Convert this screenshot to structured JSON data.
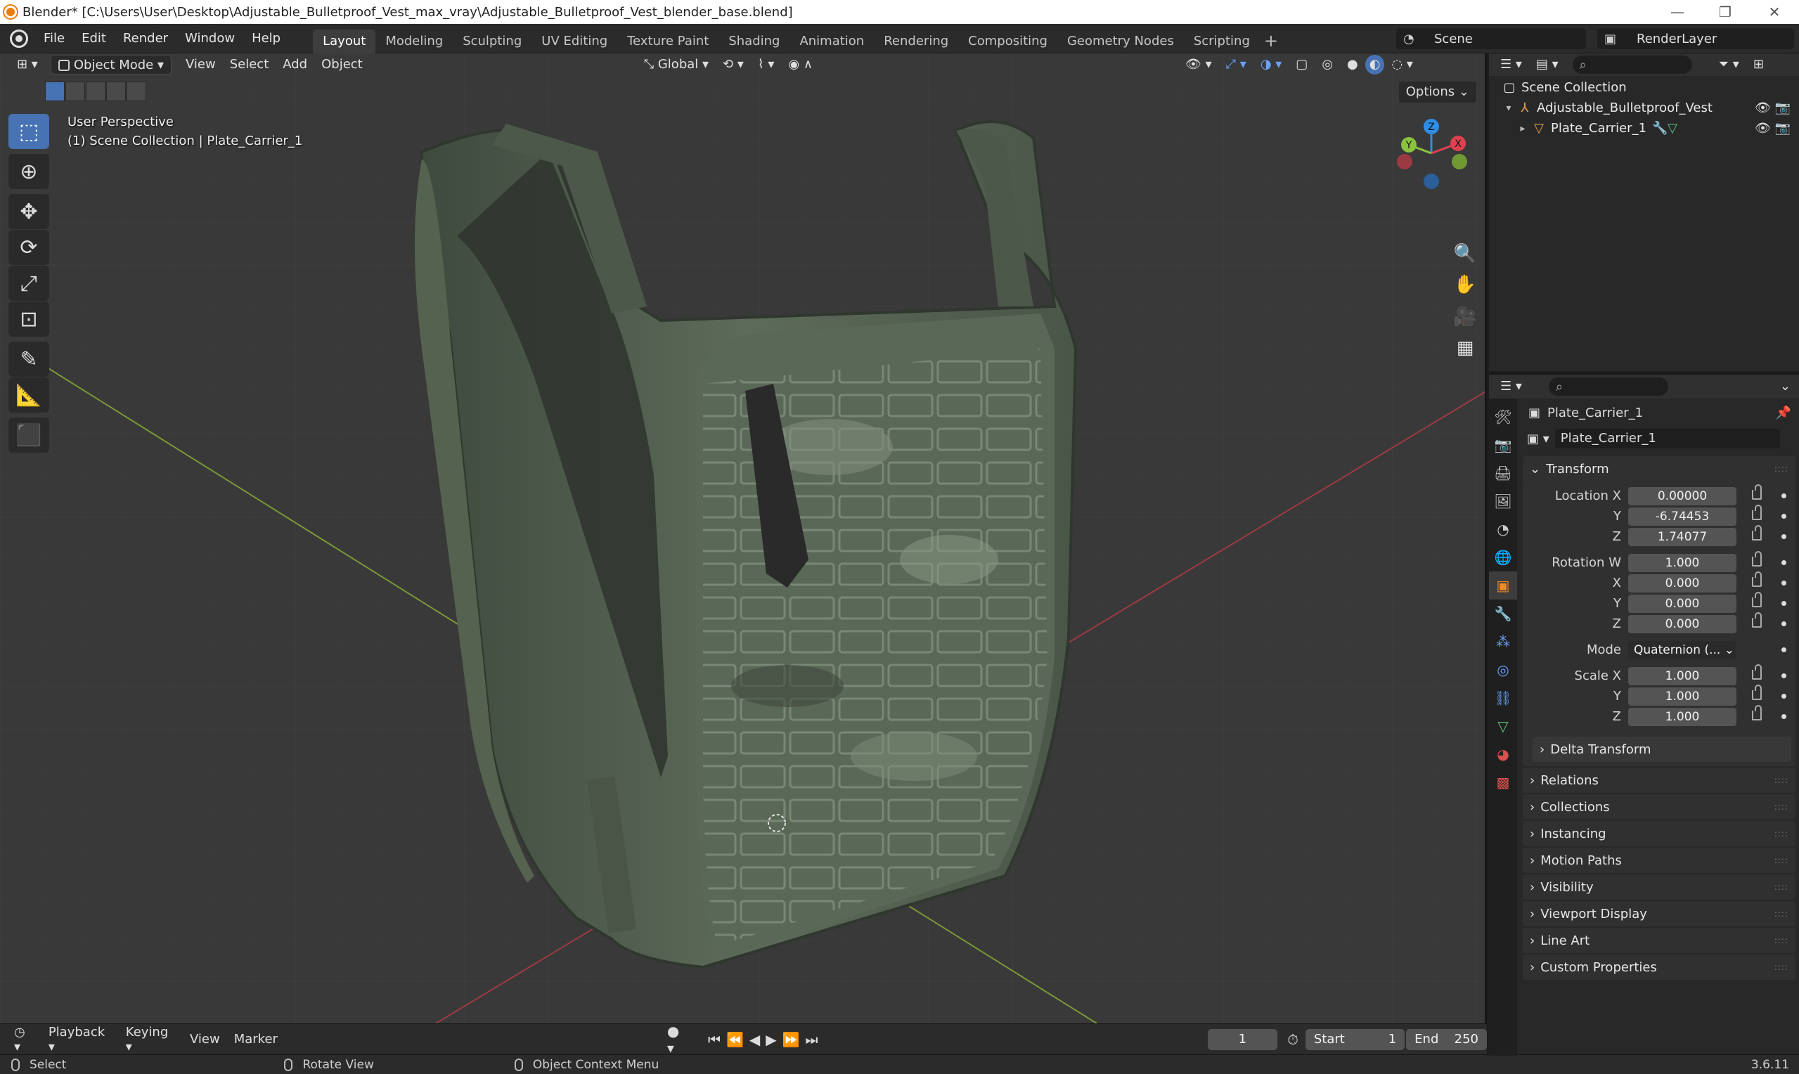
{
  "window": {
    "title": "Blender* [C:\\Users\\User\\Desktop\\Adjustable_Bulletproof_Vest_max_vray\\Adjustable_Bulletproof_Vest_blender_base.blend]"
  },
  "menu": [
    "File",
    "Edit",
    "Render",
    "Window",
    "Help"
  ],
  "workspaces": [
    "Layout",
    "Modeling",
    "Sculpting",
    "UV Editing",
    "Texture Paint",
    "Shading",
    "Animation",
    "Rendering",
    "Compositing",
    "Geometry Nodes",
    "Scripting"
  ],
  "active_workspace": "Layout",
  "scene": "Scene",
  "render_layer": "RenderLayer",
  "viewport": {
    "mode": "Object Mode",
    "menus": [
      "View",
      "Select",
      "Add",
      "Object"
    ],
    "orientation": "Global",
    "options_label": "Options",
    "perspective": "User Perspective",
    "collection_info": "(1) Scene Collection | Plate_Carrier_1",
    "gizmo_labels": {
      "z": "Z",
      "y": "Y",
      "x": "X"
    }
  },
  "outliner": {
    "root": "Scene Collection",
    "rows": [
      {
        "label": "Adjustable_Bulletproof_Vest"
      },
      {
        "label": "Plate_Carrier_1"
      }
    ]
  },
  "properties": {
    "object_name": "Plate_Carrier_1",
    "object_field": "Plate_Carrier_1",
    "transform_label": "Transform",
    "location": {
      "label": "Location X",
      "x": "0.00000",
      "y": "-6.74453",
      "z": "1.74077"
    },
    "rotation": {
      "label": "Rotation W",
      "w": "1.000",
      "x": "0.000",
      "y": "0.000",
      "z": "0.000"
    },
    "mode": {
      "label": "Mode",
      "value": "Quaternion (..."
    },
    "scale": {
      "label": "Scale X",
      "x": "1.000",
      "y": "1.000",
      "z": "1.000"
    },
    "axis_labels": {
      "y": "Y",
      "z": "Z",
      "x": "X"
    },
    "delta_transform": "Delta Transform",
    "panels": [
      "Relations",
      "Collections",
      "Instancing",
      "Motion Paths",
      "Visibility",
      "Viewport Display",
      "Line Art",
      "Custom Properties"
    ]
  },
  "timeline": {
    "menus": [
      "Playback",
      "Keying",
      "View",
      "Marker"
    ],
    "current_frame": "1",
    "start_label": "Start",
    "start": "1",
    "end_label": "End",
    "end": "250"
  },
  "status": {
    "select": "Select",
    "rotate_view": "Rotate View",
    "context_menu": "Object Context Menu",
    "version": "3.6.11"
  },
  "colors": {
    "accent": "#4772b3",
    "axis_x": "#e0414f",
    "axis_y": "#8ac33d",
    "axis_z": "#2e8ee6",
    "vest": "#5d6b5a"
  }
}
